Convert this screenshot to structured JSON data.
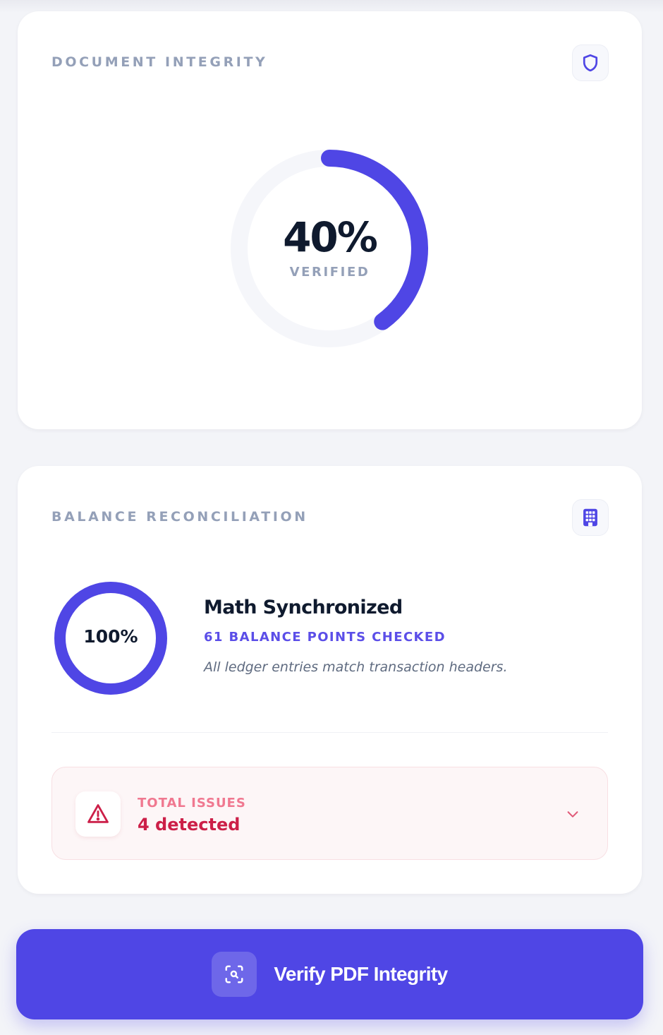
{
  "integrity": {
    "title": "DOCUMENT INTEGRITY",
    "icon": "shield-icon",
    "percent": 40,
    "percent_label": "40%",
    "status_label": "VERIFIED"
  },
  "balance": {
    "title": "BALANCE RECONCILIATION",
    "icon": "calculator-icon",
    "percent": 100,
    "percent_label": "100%",
    "status_title": "Math Synchronized",
    "checked_label": "61 BALANCE POINTS CHECKED",
    "note": "All ledger entries match transaction headers."
  },
  "issues": {
    "label": "TOTAL ISSUES",
    "value": "4 detected",
    "icon": "warning-icon",
    "expand_icon": "chevron-down-icon"
  },
  "action": {
    "label": "Verify PDF Integrity",
    "icon": "scan-search-icon"
  },
  "colors": {
    "accent": "#4f46e5",
    "track": "#f5f6fa",
    "danger": "#cc1f48",
    "danger_light": "#f07890",
    "muted": "#94a0b8",
    "ink": "#0f1a2e"
  }
}
